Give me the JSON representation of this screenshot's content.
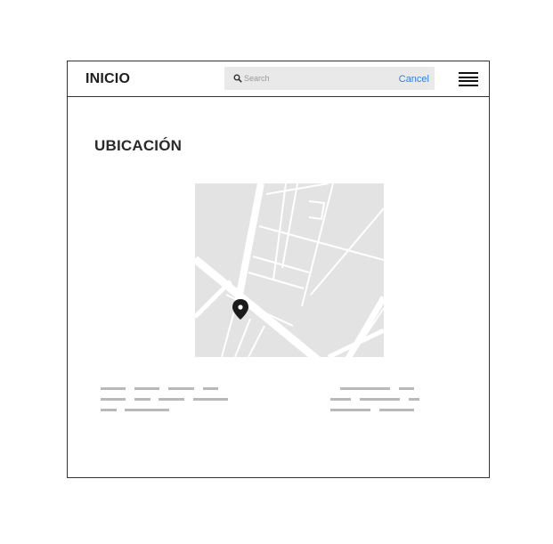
{
  "header": {
    "home_label": "INICIO",
    "search": {
      "placeholder": "Search",
      "value": ""
    },
    "cancel_label": "Cancel",
    "menu_icon": "hamburger-menu-icon"
  },
  "page": {
    "title": "UBICACIÓN"
  },
  "map": {
    "pin_icon": "location-pin-icon"
  },
  "colors": {
    "link": "#2f7fe0",
    "map_background": "#e3e3e3",
    "map_roads": "#ffffff",
    "placeholder_text_bars": "#b9b9b9"
  }
}
